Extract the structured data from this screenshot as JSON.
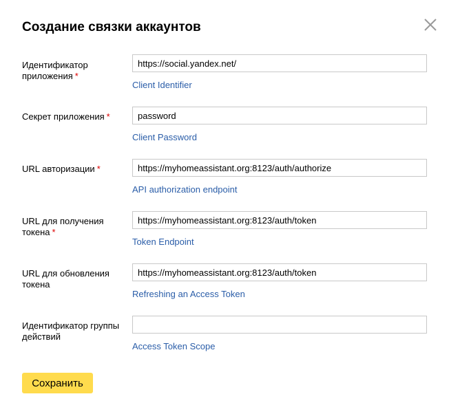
{
  "dialog": {
    "title": "Создание связки аккаунтов",
    "close_icon": "close-icon",
    "required_mark": "*"
  },
  "fields": [
    {
      "label": "Идентификатор приложения",
      "required": true,
      "value": "https://social.yandex.net/",
      "hint": "Client Identifier"
    },
    {
      "label": "Секрет приложения",
      "required": true,
      "value": "password",
      "hint": "Client Password"
    },
    {
      "label": "URL авторизации",
      "required": true,
      "value": "https://myhomeassistant.org:8123/auth/authorize",
      "hint": "API authorization endpoint"
    },
    {
      "label": "URL для получения токена",
      "required": true,
      "value": "https://myhomeassistant.org:8123/auth/token",
      "hint": "Token Endpoint"
    },
    {
      "label": "URL для обновления токена",
      "required": false,
      "value": "https://myhomeassistant.org:8123/auth/token",
      "hint": "Refreshing an Access Token"
    },
    {
      "label": "Идентификатор группы действий",
      "required": false,
      "value": "",
      "hint": "Access Token Scope"
    }
  ],
  "actions": {
    "save_label": "Сохранить"
  },
  "colors": {
    "accent_button": "#ffdb4d",
    "link": "#2a5da8",
    "required": "#dd0000"
  }
}
